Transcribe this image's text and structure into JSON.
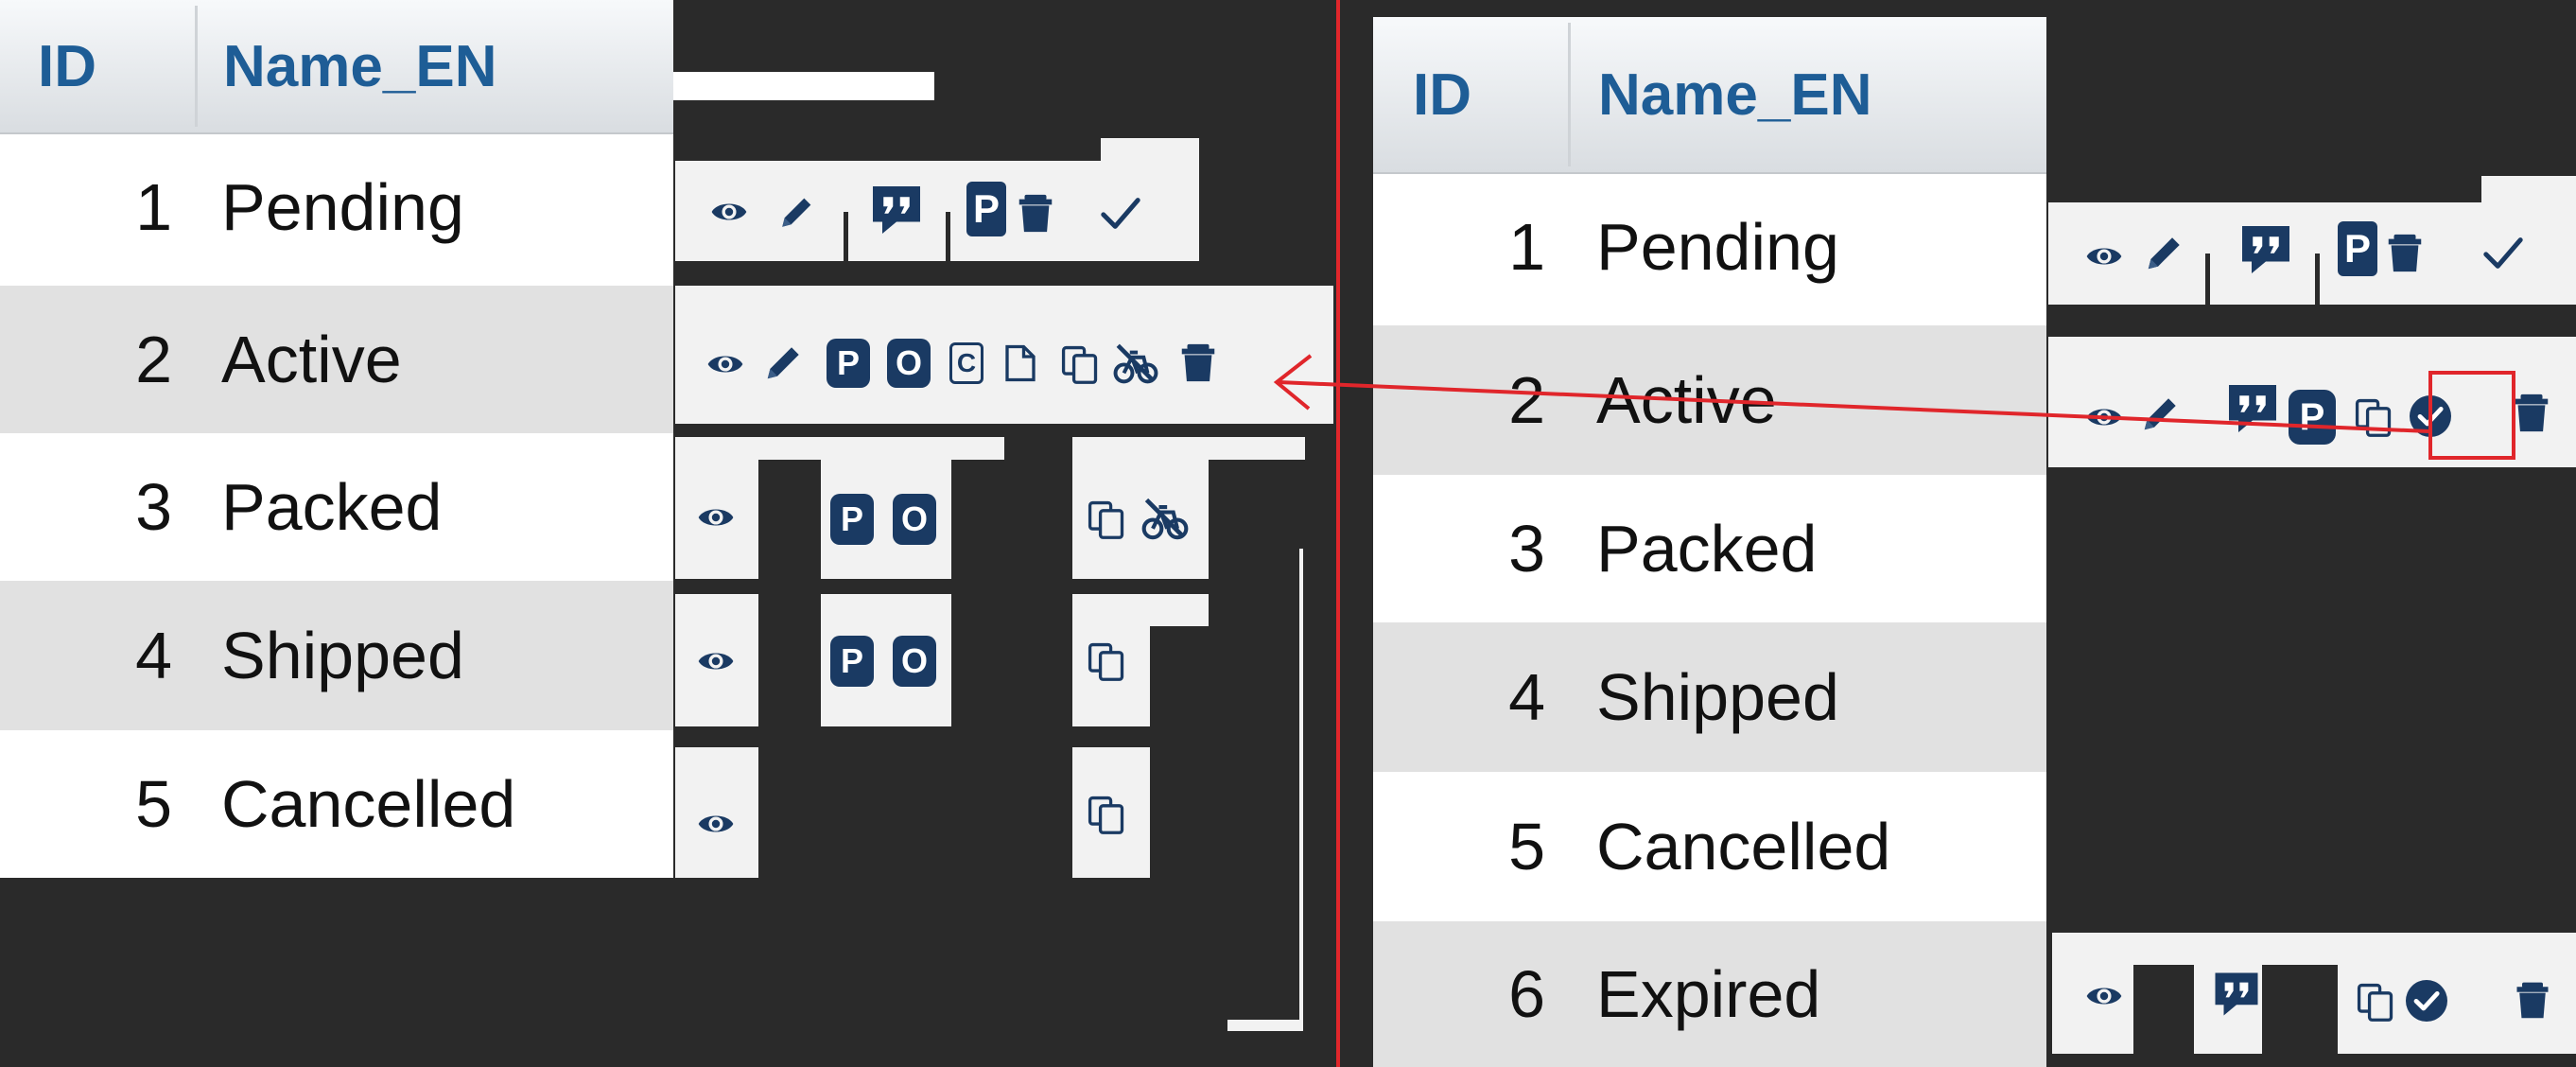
{
  "colors": {
    "background": "#2a2a2a",
    "header_text": "#1e5d96",
    "icon": "#1a3a63",
    "divider": "#e0262b",
    "row_alt": "#e1e1e1",
    "row": "#ffffff",
    "panel": "#f2f2f2"
  },
  "left_table": {
    "headers": {
      "id": "ID",
      "name": "Name_EN"
    },
    "rows": [
      {
        "id": "1",
        "name": "Pending"
      },
      {
        "id": "2",
        "name": "Active"
      },
      {
        "id": "3",
        "name": "Packed"
      },
      {
        "id": "4",
        "name": "Shipped"
      },
      {
        "id": "5",
        "name": "Cancelled"
      }
    ]
  },
  "right_table": {
    "headers": {
      "id": "ID",
      "name": "Name_EN"
    },
    "rows": [
      {
        "id": "1",
        "name": "Pending"
      },
      {
        "id": "2",
        "name": "Active"
      },
      {
        "id": "3",
        "name": "Packed"
      },
      {
        "id": "4",
        "name": "Shipped"
      },
      {
        "id": "5",
        "name": "Cancelled"
      },
      {
        "id": "6",
        "name": "Expired"
      }
    ]
  },
  "badges": {
    "p": "P",
    "o": "O",
    "c": "C"
  },
  "icon_names": [
    "view-icon",
    "edit-icon",
    "quote-icon",
    "p-badge-icon",
    "o-badge-icon",
    "c-badge-icon",
    "document-icon",
    "copy-icon",
    "cancel-bike-icon",
    "trash-icon",
    "check-icon",
    "check-circle-icon"
  ]
}
